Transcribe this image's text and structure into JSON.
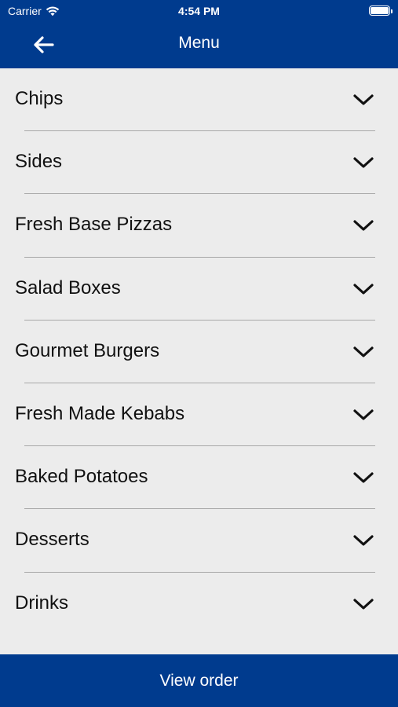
{
  "status_bar": {
    "carrier": "Carrier",
    "time": "4:54 PM",
    "wifi_icon": "wifi-icon",
    "battery_icon": "battery-icon"
  },
  "nav": {
    "title": "Menu",
    "back_icon": "arrow-left-icon"
  },
  "menu": {
    "items": [
      {
        "label": "Chips"
      },
      {
        "label": "Sides"
      },
      {
        "label": "Fresh Base Pizzas"
      },
      {
        "label": "Salad Boxes"
      },
      {
        "label": "Gourmet Burgers"
      },
      {
        "label": "Fresh Made Kebabs"
      },
      {
        "label": "Baked Potatoes"
      },
      {
        "label": "Desserts"
      },
      {
        "label": "Drinks"
      }
    ],
    "expand_icon": "chevron-down-icon"
  },
  "footer": {
    "button_label": "View order"
  },
  "colors": {
    "brand_blue": "#003b8e",
    "background": "#ececec",
    "text": "#111111",
    "divider": "#a8a8a8"
  }
}
